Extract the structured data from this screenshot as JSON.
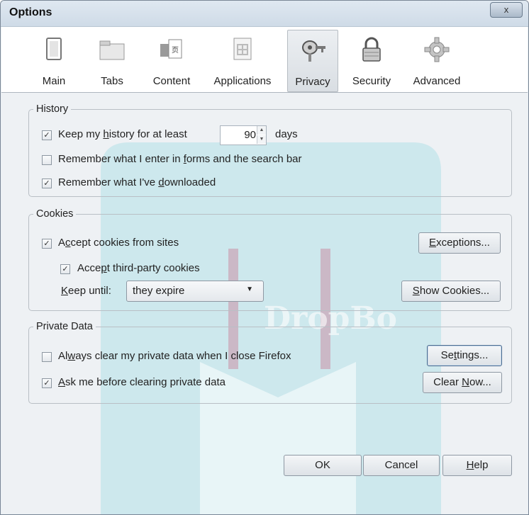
{
  "window": {
    "title": "Options",
    "close_glyph": "x"
  },
  "toolbar": {
    "items": [
      {
        "label": "Main",
        "icon": "window-icon"
      },
      {
        "label": "Tabs",
        "icon": "folder-tabs-icon"
      },
      {
        "label": "Content",
        "icon": "content-icon"
      },
      {
        "label": "Applications",
        "icon": "applications-icon"
      },
      {
        "label": "Privacy",
        "icon": "mask-key-icon",
        "selected": true
      },
      {
        "label": "Security",
        "icon": "padlock-icon"
      },
      {
        "label": "Advanced",
        "icon": "gear-icon"
      }
    ]
  },
  "history": {
    "legend": "History",
    "keep_history": {
      "pre": "Keep my ",
      "accel": "h",
      "post": "istory for at least",
      "checked": true
    },
    "days_value": "90",
    "days_label": "days",
    "remember_forms": {
      "pre": "Remember what I enter in ",
      "accel": "f",
      "post": "orms and the search bar",
      "checked": false
    },
    "remember_downloads": {
      "pre": "Remember what I've ",
      "accel": "d",
      "post": "ownloaded",
      "checked": true
    }
  },
  "cookies": {
    "legend": "Cookies",
    "accept_cookies": {
      "pre": "A",
      "accel": "c",
      "post": "cept cookies from sites",
      "checked": true
    },
    "accept_third_party": {
      "pre": "Acce",
      "accel": "p",
      "post": "t third-party cookies",
      "checked": true
    },
    "keep_until": {
      "pre": "",
      "accel": "K",
      "post": "eep until:"
    },
    "keep_until_value": "they expire",
    "exceptions_button": {
      "pre": "",
      "accel": "E",
      "post": "xceptions..."
    },
    "show_cookies_button": {
      "pre": "",
      "accel": "S",
      "post": "how Cookies..."
    }
  },
  "private_data": {
    "legend": "Private Data",
    "always_clear": {
      "pre": "Al",
      "accel": "w",
      "post": "ays clear my private data when I close Firefox",
      "checked": false
    },
    "ask_before": {
      "pre": "",
      "accel": "A",
      "post": "sk me before clearing private data",
      "checked": true
    },
    "settings_button": {
      "pre": "Se",
      "accel": "t",
      "post": "tings..."
    },
    "clear_now_button": {
      "pre": "Clear ",
      "accel": "N",
      "post": "ow..."
    }
  },
  "footer": {
    "ok": "OK",
    "cancel": "Cancel",
    "help": {
      "pre": "",
      "accel": "H",
      "post": "elp"
    }
  },
  "watermark": {
    "text": "DropBo",
    "color": "#5cc8d8",
    "accent": "#c95f7d"
  },
  "colors": {
    "check": "#333333",
    "selected_tab": "#d9dee3"
  }
}
